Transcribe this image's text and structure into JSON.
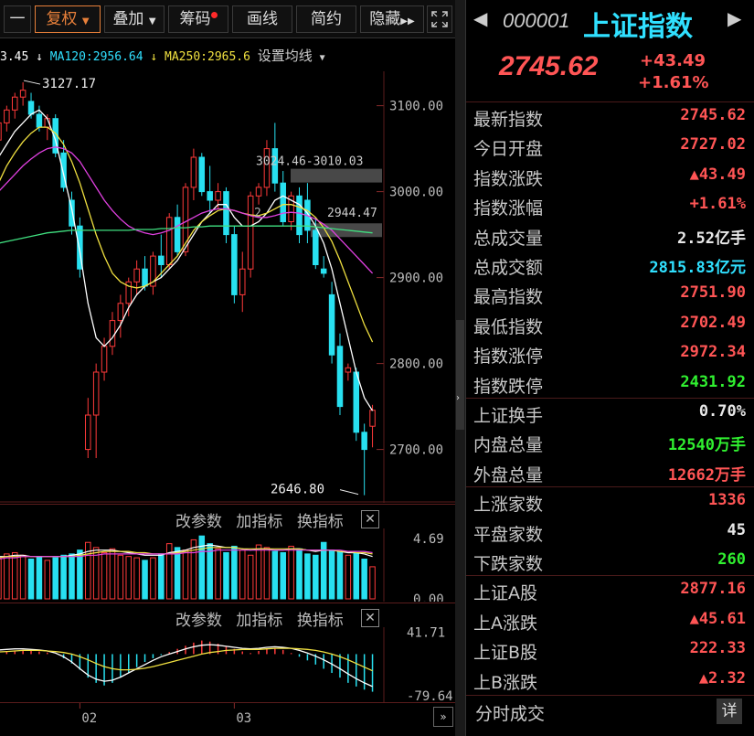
{
  "toolbar": {
    "items": [
      "一",
      "复权",
      "叠加",
      "筹码",
      "画线",
      "简约",
      "隐藏"
    ],
    "fullscreen_icon": "expand-icon"
  },
  "ma_line": {
    "ma_a_value": "3.45",
    "ma120_label": "MA120:2956.64",
    "ma250_label": "MA250:2965.6",
    "settings_label": "设置均线"
  },
  "panel_tools": {
    "change_params": "改参数",
    "add_indicator": "加指标",
    "switch_indicator": "换指标"
  },
  "colors": {
    "up": "#ff3a3a",
    "down": "#28e0f0",
    "ma_white": "#ffffff",
    "ma_yellow": "#f0e040",
    "ma_magenta": "#e040e0",
    "ma_green": "#40e080",
    "value_red": "#ff5555",
    "value_green": "#30f030",
    "value_cyan": "#30e0ff"
  },
  "chart_data": [
    {
      "type": "candlestick",
      "ylim": [
        2640,
        3140
      ],
      "yticks": [
        "3100.00",
        "3000.00",
        "2900.00",
        "2800.00",
        "2700.00"
      ],
      "ytick_values": [
        3100,
        3000,
        2900,
        2800,
        2700
      ],
      "annotations": {
        "high_label": "3127.17",
        "low_label": "2646.80",
        "range_label": "3024.46-3010.03",
        "mid_label": "2944.47",
        "mid_prefix": "2"
      },
      "candles": [
        {
          "o": 3060,
          "h": 3085,
          "l": 3050,
          "c": 3080
        },
        {
          "o": 3080,
          "h": 3100,
          "l": 3070,
          "c": 3095
        },
        {
          "o": 3095,
          "h": 3115,
          "l": 3085,
          "c": 3110
        },
        {
          "o": 3110,
          "h": 3127.17,
          "l": 3100,
          "c": 3118
        },
        {
          "o": 3105,
          "h": 3115,
          "l": 3085,
          "c": 3090
        },
        {
          "o": 3090,
          "h": 3100,
          "l": 3070,
          "c": 3075
        },
        {
          "o": 3075,
          "h": 3090,
          "l": 3060,
          "c": 3085
        },
        {
          "o": 3085,
          "h": 3090,
          "l": 3040,
          "c": 3045
        },
        {
          "o": 3045,
          "h": 3060,
          "l": 3000,
          "c": 3005
        },
        {
          "o": 2990,
          "h": 3000,
          "l": 2950,
          "c": 2960
        },
        {
          "o": 2960,
          "h": 2970,
          "l": 2900,
          "c": 2910
        },
        {
          "o": 2700,
          "h": 2760,
          "l": 2690,
          "c": 2740
        },
        {
          "o": 2740,
          "h": 2800,
          "l": 2690,
          "c": 2790
        },
        {
          "o": 2790,
          "h": 2830,
          "l": 2780,
          "c": 2820
        },
        {
          "o": 2820,
          "h": 2860,
          "l": 2810,
          "c": 2850
        },
        {
          "o": 2850,
          "h": 2880,
          "l": 2830,
          "c": 2870
        },
        {
          "o": 2870,
          "h": 2900,
          "l": 2855,
          "c": 2895
        },
        {
          "o": 2895,
          "h": 2920,
          "l": 2880,
          "c": 2910
        },
        {
          "o": 2910,
          "h": 2925,
          "l": 2885,
          "c": 2890
        },
        {
          "o": 2890,
          "h": 2930,
          "l": 2880,
          "c": 2925
        },
        {
          "o": 2925,
          "h": 2950,
          "l": 2900,
          "c": 2915
        },
        {
          "o": 2915,
          "h": 2975,
          "l": 2910,
          "c": 2970
        },
        {
          "o": 2970,
          "h": 2985,
          "l": 2925,
          "c": 2930
        },
        {
          "o": 2930,
          "h": 3010,
          "l": 2925,
          "c": 3005
        },
        {
          "o": 3005,
          "h": 3050,
          "l": 2990,
          "c": 3040
        },
        {
          "o": 3040,
          "h": 3045,
          "l": 2995,
          "c": 3000
        },
        {
          "o": 3000,
          "h": 3030,
          "l": 2975,
          "c": 2990
        },
        {
          "o": 2990,
          "h": 3010,
          "l": 2980,
          "c": 3000
        },
        {
          "o": 3000,
          "h": 3005,
          "l": 2940,
          "c": 2950
        },
        {
          "o": 2950,
          "h": 2960,
          "l": 2870,
          "c": 2880
        },
        {
          "o": 2880,
          "h": 2930,
          "l": 2860,
          "c": 2910
        },
        {
          "o": 2910,
          "h": 3000,
          "l": 2900,
          "c": 2995
        },
        {
          "o": 2995,
          "h": 3010,
          "l": 2985,
          "c": 3005
        },
        {
          "o": 3005,
          "h": 3060,
          "l": 2995,
          "c": 3050
        },
        {
          "o": 3050,
          "h": 3080,
          "l": 3000,
          "c": 3010
        },
        {
          "o": 3010,
          "h": 3024,
          "l": 2960,
          "c": 2965
        },
        {
          "o": 2965,
          "h": 3000,
          "l": 2955,
          "c": 2995
        },
        {
          "o": 2995,
          "h": 3005,
          "l": 2940,
          "c": 2950
        },
        {
          "o": 2990,
          "h": 3010,
          "l": 2940,
          "c": 2955
        },
        {
          "o": 2955,
          "h": 2970,
          "l": 2910,
          "c": 2915
        },
        {
          "o": 2910,
          "h": 2925,
          "l": 2900,
          "c": 2905
        },
        {
          "o": 2880,
          "h": 2895,
          "l": 2800,
          "c": 2810
        },
        {
          "o": 2820,
          "h": 2835,
          "l": 2740,
          "c": 2750
        },
        {
          "o": 2790,
          "h": 2800,
          "l": 2780,
          "c": 2795
        },
        {
          "o": 2790,
          "h": 2795,
          "l": 2710,
          "c": 2720
        },
        {
          "o": 2720,
          "h": 2730,
          "l": 2646.8,
          "c": 2700
        },
        {
          "o": 2727.02,
          "h": 2751.9,
          "l": 2702.49,
          "c": 2745.62
        }
      ],
      "ma_white": [
        3040,
        3055,
        3070,
        3080,
        3090,
        3095,
        3085,
        3060,
        3020,
        2980,
        2930,
        2870,
        2830,
        2820,
        2830,
        2845,
        2865,
        2880,
        2890,
        2895,
        2900,
        2910,
        2920,
        2935,
        2950,
        2965,
        2975,
        2985,
        2985,
        2970,
        2960,
        2960,
        2965,
        2975,
        2990,
        2995,
        2990,
        2985,
        2975,
        2960,
        2940,
        2910,
        2870,
        2830,
        2790,
        2760,
        2745
      ],
      "ma_yellow": [
        3010,
        3030,
        3045,
        3058,
        3068,
        3075,
        3075,
        3068,
        3055,
        3035,
        3010,
        2980,
        2950,
        2925,
        2905,
        2895,
        2890,
        2888,
        2890,
        2895,
        2905,
        2915,
        2925,
        2940,
        2955,
        2965,
        2972,
        2978,
        2980,
        2978,
        2975,
        2973,
        2972,
        2975,
        2980,
        2985,
        2985,
        2982,
        2978,
        2970,
        2958,
        2942,
        2920,
        2895,
        2870,
        2845,
        2825
      ],
      "ma_magenta": [
        3000,
        3010,
        3020,
        3030,
        3038,
        3045,
        3050,
        3052,
        3050,
        3045,
        3035,
        3020,
        3005,
        2990,
        2978,
        2968,
        2960,
        2955,
        2952,
        2950,
        2952,
        2955,
        2960,
        2965,
        2970,
        2975,
        2978,
        2980,
        2980,
        2978,
        2975,
        2972,
        2970,
        2970,
        2972,
        2975,
        2976,
        2975,
        2972,
        2968,
        2962,
        2955,
        2945,
        2935,
        2925,
        2915,
        2905
      ],
      "ma_green": [
        2940,
        2942,
        2944,
        2946,
        2948,
        2950,
        2952,
        2953,
        2954,
        2955,
        2955,
        2955,
        2955,
        2955,
        2955,
        2955,
        2955,
        2956,
        2956,
        2956,
        2957,
        2957,
        2958,
        2958,
        2959,
        2959,
        2960,
        2960,
        2960,
        2960,
        2960,
        2960,
        2960,
        2960,
        2960,
        2960,
        2960,
        2960,
        2960,
        2959,
        2958,
        2957,
        2956,
        2955,
        2954,
        2953,
        2952
      ]
    },
    {
      "type": "bar",
      "ylim": [
        0,
        5.2
      ],
      "yticks": [
        "4.69",
        "0.00"
      ],
      "ytick_values": [
        4.69,
        0
      ],
      "values": [
        3.2,
        3.5,
        3.6,
        3.4,
        3.1,
        3.3,
        3.0,
        3.2,
        3.4,
        3.5,
        3.8,
        4.4,
        4.0,
        3.6,
        3.9,
        3.4,
        3.3,
        3.2,
        3.0,
        3.2,
        3.5,
        4.3,
        4.0,
        3.8,
        4.6,
        4.9,
        4.3,
        3.9,
        3.6,
        4.1,
        3.8,
        3.4,
        4.2,
        4.0,
        3.7,
        3.6,
        4.1,
        3.9,
        3.5,
        3.4,
        4.4,
        3.8,
        3.7,
        3.4,
        3.6,
        3.1,
        2.5
      ],
      "up": [
        true,
        true,
        true,
        true,
        false,
        false,
        true,
        false,
        false,
        false,
        false,
        true,
        true,
        true,
        true,
        true,
        true,
        true,
        false,
        true,
        false,
        true,
        false,
        true,
        true,
        false,
        false,
        true,
        false,
        false,
        true,
        true,
        true,
        true,
        false,
        false,
        true,
        false,
        false,
        false,
        false,
        false,
        false,
        true,
        false,
        false,
        true
      ],
      "ma_white": [
        3.3,
        3.3,
        3.4,
        3.4,
        3.3,
        3.3,
        3.3,
        3.3,
        3.3,
        3.4,
        3.5,
        3.7,
        3.8,
        3.8,
        3.8,
        3.7,
        3.6,
        3.5,
        3.4,
        3.4,
        3.4,
        3.6,
        3.7,
        3.8,
        4.0,
        4.1,
        4.2,
        4.1,
        4.0,
        4.0,
        3.9,
        3.8,
        3.9,
        3.9,
        3.8,
        3.8,
        3.9,
        3.9,
        3.8,
        3.7,
        3.8,
        3.8,
        3.7,
        3.6,
        3.6,
        3.5,
        3.3
      ],
      "ma_yellow": [
        3.2,
        3.3,
        3.3,
        3.3,
        3.3,
        3.3,
        3.3,
        3.3,
        3.3,
        3.3,
        3.4,
        3.5,
        3.6,
        3.7,
        3.7,
        3.7,
        3.7,
        3.6,
        3.6,
        3.5,
        3.5,
        3.5,
        3.6,
        3.7,
        3.8,
        3.9,
        4.0,
        4.0,
        4.0,
        4.0,
        3.9,
        3.9,
        3.9,
        3.9,
        3.9,
        3.9,
        3.9,
        3.9,
        3.8,
        3.8,
        3.8,
        3.8,
        3.7,
        3.7,
        3.6,
        3.6,
        3.5
      ],
      "ma_magenta": [
        3.1,
        3.2,
        3.2,
        3.3,
        3.3,
        3.3,
        3.3,
        3.3,
        3.3,
        3.3,
        3.3,
        3.4,
        3.4,
        3.5,
        3.5,
        3.5,
        3.5,
        3.5,
        3.5,
        3.5,
        3.5,
        3.5,
        3.5,
        3.6,
        3.6,
        3.7,
        3.7,
        3.8,
        3.8,
        3.8,
        3.8,
        3.8,
        3.8,
        3.8,
        3.8,
        3.8,
        3.8,
        3.8,
        3.8,
        3.8,
        3.8,
        3.8,
        3.8,
        3.7,
        3.7,
        3.7,
        3.6
      ]
    },
    {
      "type": "bar",
      "ylim": [
        -85,
        48
      ],
      "yticks": [
        "41.71",
        "-79.64"
      ],
      "ytick_values": [
        41.71,
        -79.64
      ],
      "x_labels": [
        "02",
        "03"
      ],
      "x_label_index": [
        10,
        29
      ],
      "values": [
        5,
        6,
        7,
        8,
        7,
        5,
        3,
        0,
        -8,
        -18,
        -30,
        -45,
        -55,
        -60,
        -55,
        -45,
        -35,
        -25,
        -15,
        -8,
        -2,
        4,
        10,
        16,
        22,
        26,
        24,
        20,
        15,
        10,
        5,
        2,
        6,
        10,
        12,
        8,
        2,
        -5,
        -12,
        -20,
        -28,
        -36,
        -45,
        -55,
        -62,
        -68,
        -72
      ],
      "dif": [
        8,
        9,
        10,
        10,
        9,
        8,
        6,
        2,
        -5,
        -15,
        -28,
        -40,
        -48,
        -52,
        -50,
        -44,
        -36,
        -28,
        -20,
        -12,
        -5,
        0,
        5,
        10,
        14,
        17,
        18,
        17,
        15,
        13,
        11,
        10,
        11,
        13,
        14,
        13,
        11,
        7,
        2,
        -4,
        -11,
        -19,
        -28,
        -38,
        -47,
        -55,
        -62
      ],
      "dea": [
        4,
        5,
        6,
        7,
        7,
        7,
        6,
        5,
        3,
        0,
        -5,
        -11,
        -18,
        -24,
        -28,
        -30,
        -30,
        -29,
        -27,
        -24,
        -20,
        -16,
        -12,
        -8,
        -4,
        0,
        3,
        5,
        7,
        8,
        9,
        9,
        9,
        10,
        11,
        11,
        11,
        10,
        9,
        7,
        4,
        0,
        -5,
        -11,
        -18,
        -25,
        -32
      ]
    }
  ],
  "right_panel": {
    "code": "000001",
    "name": "上证指数",
    "price": "2745.62",
    "change": "+43.49",
    "change_pct": "+1.61%",
    "rows": [
      {
        "label": "最新指数",
        "value": "2745.62",
        "color": "#ff5555"
      },
      {
        "label": "今日开盘",
        "value": "2727.02",
        "color": "#ff5555"
      },
      {
        "label": "指数涨跌",
        "value": "▲43.49",
        "color": "#ff5555"
      },
      {
        "label": "指数涨幅",
        "value": "+1.61%",
        "color": "#ff5555"
      },
      {
        "label": "总成交量",
        "value": "2.52亿手",
        "color": "#e8e8e8"
      },
      {
        "label": "总成交额",
        "value": "2815.83亿元",
        "color": "#30e0ff"
      },
      {
        "label": "最高指数",
        "value": "2751.90",
        "color": "#ff5555"
      },
      {
        "label": "最低指数",
        "value": "2702.49",
        "color": "#ff5555"
      },
      {
        "label": "指数涨停",
        "value": "2972.34",
        "color": "#ff5555"
      },
      {
        "label": "指数跌停",
        "value": "2431.92",
        "color": "#30f030"
      },
      {
        "label": "上证换手",
        "value": "0.70%",
        "color": "#e8e8e8"
      },
      {
        "label": "内盘总量",
        "value": "12540万手",
        "color": "#30f030"
      },
      {
        "label": "外盘总量",
        "value": "12662万手",
        "color": "#ff5555"
      },
      {
        "label": "上涨家数",
        "value": "1336",
        "color": "#ff5555"
      },
      {
        "label": "平盘家数",
        "value": "45",
        "color": "#e8e8e8"
      },
      {
        "label": "下跌家数",
        "value": "260",
        "color": "#30f030"
      },
      {
        "label": "上证A股",
        "value": "2877.16",
        "color": "#ff5555"
      },
      {
        "label": "上A涨跌",
        "value": "▲45.61",
        "color": "#ff5555"
      },
      {
        "label": "上证B股",
        "value": "222.33",
        "color": "#ff5555"
      },
      {
        "label": "上B涨跌",
        "value": "▲2.32",
        "color": "#ff5555"
      }
    ],
    "footer_label": "分时成交",
    "footer_button": "详"
  }
}
